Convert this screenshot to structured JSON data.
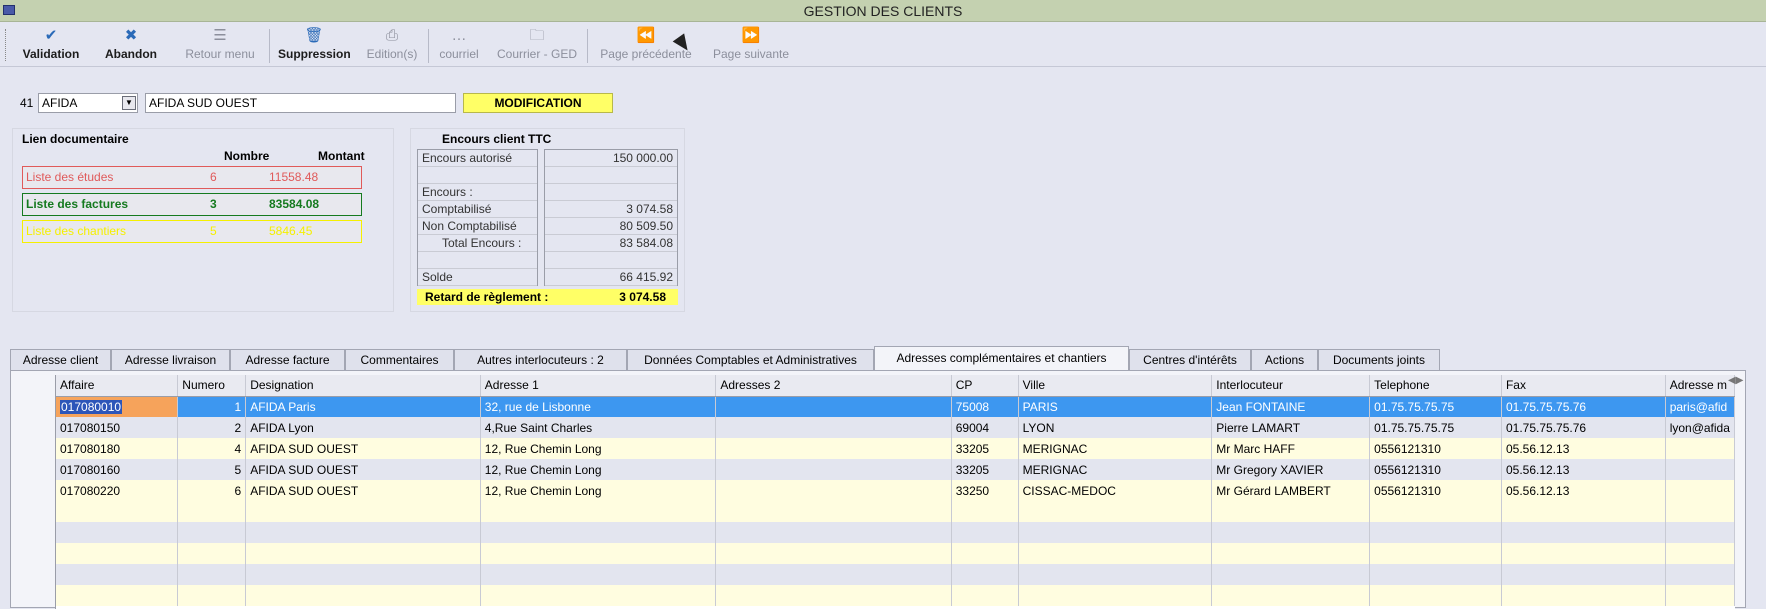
{
  "window": {
    "title": "GESTION DES CLIENTS"
  },
  "toolbar": {
    "items": [
      {
        "label": "Validation",
        "icon": "check-circle-icon",
        "glyph": "✔",
        "enabled": true
      },
      {
        "label": "Abandon",
        "icon": "cancel-circle-icon",
        "glyph": "✖",
        "enabled": true
      },
      {
        "label": "Retour menu",
        "icon": "menu-list-icon",
        "glyph": "☰",
        "enabled": false
      },
      {
        "label": "Suppression",
        "icon": "trash-icon",
        "glyph": "🗑",
        "enabled": true
      },
      {
        "label": "Edition(s)",
        "icon": "printer-icon",
        "glyph": "⎙",
        "enabled": false
      },
      {
        "label": "courriel",
        "icon": "ellipsis-icon",
        "glyph": "…",
        "enabled": false
      },
      {
        "label": "Courrier - GED",
        "icon": "folder-icon",
        "glyph": "🗀",
        "enabled": false
      },
      {
        "label": "Page précédente",
        "icon": "rewind-icon",
        "glyph": "⏪",
        "enabled": false
      },
      {
        "label": "Page suivante",
        "icon": "fast-forward-icon",
        "glyph": "⏩",
        "enabled": false
      }
    ]
  },
  "client": {
    "number": "41",
    "code": "AFIDA",
    "name": "AFIDA SUD OUEST",
    "mode": "MODIFICATION"
  },
  "lien_documentaire": {
    "title": "Lien documentaire",
    "col_nombre": "Nombre",
    "col_montant": "Montant",
    "rows": [
      {
        "label": "Liste des études",
        "nombre": "6",
        "montant": "11558.48",
        "color": "#e05a5a"
      },
      {
        "label": "Liste des factures",
        "nombre": "3",
        "montant": "83584.08",
        "color": "#157a1f"
      },
      {
        "label": "Liste des chantiers",
        "nombre": "5",
        "montant": "5846.45",
        "color": "#f5f000"
      }
    ]
  },
  "encours": {
    "title": "Encours client TTC",
    "rows": [
      {
        "label": "Encours autorisé",
        "value": "150 000.00"
      },
      {
        "label": "",
        "value": ""
      },
      {
        "label": "Encours :",
        "value": ""
      },
      {
        "label": "Comptabilisé",
        "value": "3 074.58"
      },
      {
        "label": "Non Comptabilisé",
        "value": "80 509.50"
      },
      {
        "label": "Total Encours :",
        "value": "83 584.08"
      },
      {
        "label": "",
        "value": ""
      },
      {
        "label": "Solde",
        "value": "66 415.92"
      }
    ],
    "retard_label": "Retard de règlement :",
    "retard_value": "3 074.58"
  },
  "tabs": [
    {
      "label": "Adresse client",
      "selected": false
    },
    {
      "label": "Adresse livraison",
      "selected": false
    },
    {
      "label": "Adresse facture",
      "selected": false
    },
    {
      "label": "Commentaires",
      "selected": false
    },
    {
      "label": "Autres interlocuteurs :  2",
      "selected": false
    },
    {
      "label": "Données Comptables et Administratives",
      "selected": false
    },
    {
      "label": "Adresses complémentaires et chantiers",
      "selected": true
    },
    {
      "label": "Centres d'intérêts",
      "selected": false
    },
    {
      "label": "Actions",
      "selected": false
    },
    {
      "label": "Documents joints",
      "selected": false
    }
  ],
  "grid": {
    "columns": [
      "Affaire",
      "Numero",
      "Designation",
      "Adresse 1",
      "Adresses 2",
      "CP",
      "Ville",
      "Interlocuteur",
      "Telephone",
      "Fax",
      "Adresse m"
    ],
    "rows": [
      [
        "017080010",
        "1",
        "AFIDA  Paris",
        "32, rue de Lisbonne",
        "",
        "75008",
        "PARIS",
        "Jean  FONTAINE",
        "01.75.75.75.75",
        "01.75.75.75.76",
        "paris@afid"
      ],
      [
        "017080150",
        "2",
        "AFIDA  Lyon",
        "4,Rue Saint Charles",
        "",
        "69004",
        "LYON",
        "Pierre  LAMART",
        "01.75.75.75.75",
        "01.75.75.75.76",
        "lyon@afida"
      ],
      [
        "017080180",
        "4",
        "AFIDA SUD OUEST",
        "12, Rue Chemin Long",
        "",
        "33205",
        "MERIGNAC",
        "Mr Marc HAFF",
        "0556121310",
        "05.56.12.13",
        ""
      ],
      [
        "017080160",
        "5",
        "AFIDA SUD OUEST",
        "12, Rue Chemin Long",
        "",
        "33205",
        "MERIGNAC",
        "Mr Gregory XAVIER",
        "0556121310",
        "05.56.12.13",
        ""
      ],
      [
        "017080220",
        "6",
        "AFIDA SUD OUEST",
        "12, Rue Chemin Long",
        "",
        "33250",
        "CISSAC-MEDOC",
        "Mr Gérard LAMBERT",
        "0556121310",
        "05.56.12.13",
        ""
      ]
    ],
    "empty_rows": 5,
    "selected_row": 0
  }
}
